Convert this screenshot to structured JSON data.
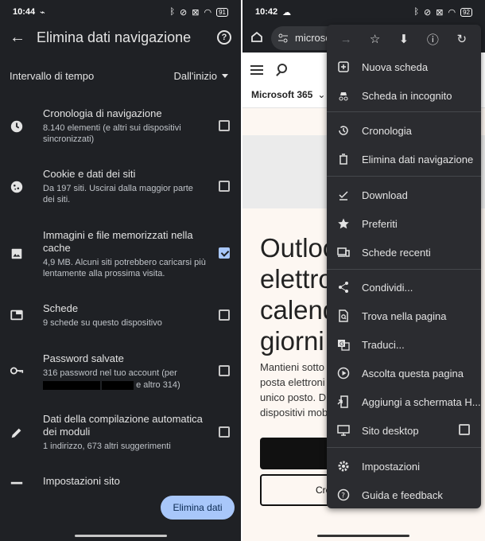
{
  "left": {
    "status": {
      "time": "10:44",
      "battery": "91"
    },
    "title": "Elimina dati navigazione",
    "time_range": {
      "label": "Intervallo di tempo",
      "value": "Dall'inizio"
    },
    "options": [
      {
        "icon": "clock-icon",
        "title": "Cronologia di navigazione",
        "subtitle": "8.140 elementi (e altri sui dispositivi sincronizzati)",
        "checked": false
      },
      {
        "icon": "cookie-icon",
        "title": "Cookie e dati dei siti",
        "subtitle": "Da 197 siti. Uscirai dalla maggior parte dei siti.",
        "checked": false
      },
      {
        "icon": "image-icon",
        "title": "Immagini e file memorizzati nella cache",
        "subtitle": "4,9 MB. Alcuni siti potrebbero caricarsi più lentamente alla prossima visita.",
        "checked": true
      },
      {
        "icon": "tab-icon",
        "title": "Schede",
        "subtitle": "9 schede su questo dispositivo",
        "checked": false
      },
      {
        "icon": "key-icon",
        "title": "Password salvate",
        "subtitle": "316 password nel tuo account (per",
        "subtitle_tail": "e altro 314)",
        "checked": false
      },
      {
        "icon": "pencil-icon",
        "title": "Dati della compilazione automatica dei moduli",
        "subtitle": "1 indirizzo, 673 altri suggerimenti",
        "checked": false
      },
      {
        "icon": "settings-icon",
        "title": "Impostazioni sito",
        "subtitle": "",
        "checked": false
      }
    ],
    "clear_button": "Elimina dati"
  },
  "right": {
    "status": {
      "time": "10:42",
      "battery": "92"
    },
    "url": "microsof",
    "site": {
      "product": "Microsoft 365",
      "hero_lines": [
        "Outloc",
        "elettro",
        "calend",
        "giorni"
      ],
      "para_lines": [
        "Mantieni sotto",
        "posta elettroni",
        "unico posto. Di",
        "dispositivi mob"
      ],
      "outline_button": "Cre"
    },
    "menu": {
      "toolbar": [
        "forward-icon",
        "star-icon",
        "download-icon",
        "info-icon",
        "refresh-icon"
      ],
      "items": [
        {
          "icon": "plus-icon",
          "label": "Nuova scheda"
        },
        {
          "icon": "incognito-icon",
          "label": "Scheda in incognito"
        },
        {
          "icon": "history-icon",
          "label": "Cronologia"
        },
        {
          "icon": "trash-icon",
          "label": "Elimina dati navigazione"
        },
        {
          "icon": "download-done-icon",
          "label": "Download"
        },
        {
          "icon": "star-filled-icon",
          "label": "Preferiti"
        },
        {
          "icon": "devices-icon",
          "label": "Schede recenti"
        },
        {
          "icon": "share-icon",
          "label": "Condividi..."
        },
        {
          "icon": "find-icon",
          "label": "Trova nella pagina"
        },
        {
          "icon": "translate-icon",
          "label": "Traduci..."
        },
        {
          "icon": "play-icon",
          "label": "Ascolta questa pagina"
        },
        {
          "icon": "add-home-icon",
          "label": "Aggiungi a schermata H..."
        },
        {
          "icon": "desktop-icon",
          "label": "Sito desktop"
        },
        {
          "icon": "gear-icon",
          "label": "Impostazioni"
        },
        {
          "icon": "help-icon",
          "label": "Guida e feedback"
        }
      ]
    }
  }
}
